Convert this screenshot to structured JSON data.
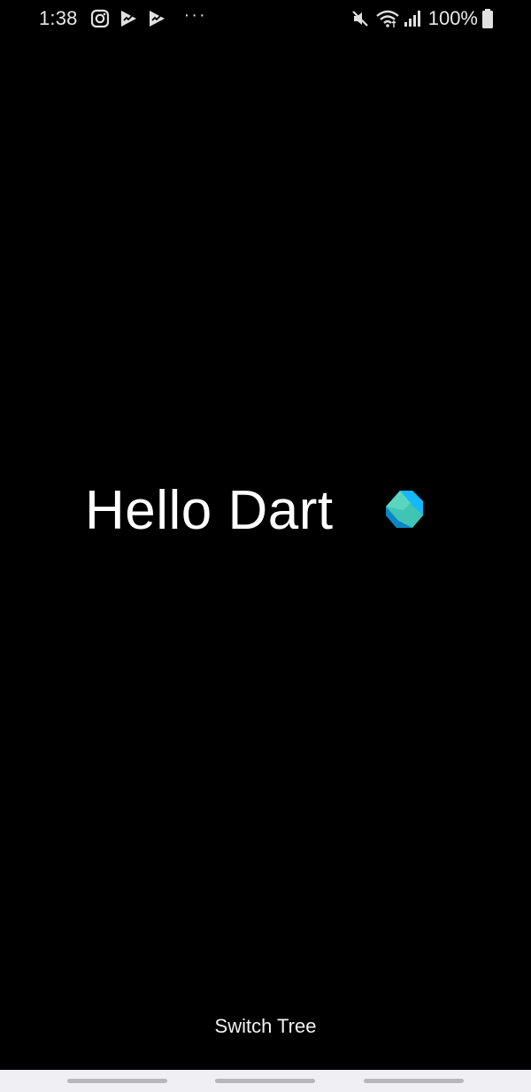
{
  "status_bar": {
    "time": "1:38",
    "notification_icons": [
      "instagram-icon",
      "play-store-icon",
      "play-store-icon"
    ],
    "more_indicator": "···",
    "system_icons": [
      "mute-icon",
      "wifi-icon",
      "signal-icon",
      "battery-icon"
    ],
    "battery_percent": "100%"
  },
  "main": {
    "greeting": "Hello Dart",
    "logo_icon": "dart-logo-icon"
  },
  "actions": {
    "switch_tree_label": "Switch Tree"
  },
  "nav_bar": {
    "buttons": [
      "recent-apps-handle",
      "home-handle",
      "back-handle"
    ]
  },
  "colors": {
    "background": "#000000",
    "text": "#ffffff",
    "nav_bar_background": "#f0eff4",
    "dart_teal": "#40c4b4",
    "dart_blue": "#0175c2"
  }
}
